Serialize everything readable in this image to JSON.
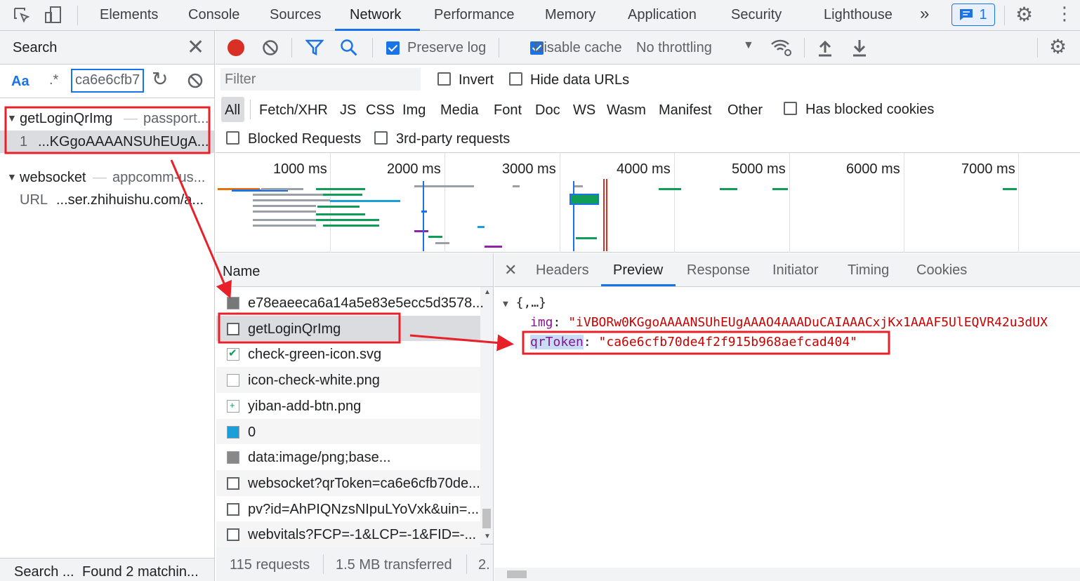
{
  "tabs": [
    "Elements",
    "Console",
    "Sources",
    "Network",
    "Performance",
    "Memory",
    "Application",
    "Security",
    "Lighthouse"
  ],
  "more_tabs": "»",
  "issues_count": "1",
  "search": {
    "title": "Search",
    "case_label": "Aa",
    "regex_label": ".*",
    "query": "ca6e6cfb7",
    "results": [
      {
        "name": "getLoginQrImg",
        "sep": "—",
        "source": "passport...",
        "line": "1",
        "match": "...KGgoAAAANSUhEUgA..."
      },
      {
        "name": "websocket",
        "sep": "—",
        "source": "appcomm-us...",
        "line": "URL",
        "match": "...ser.zhihuishu.com/a..."
      }
    ],
    "status_left": "Search ...",
    "status_right": "Found 2 matchin..."
  },
  "toolbar": {
    "preserve_log": "Preserve log",
    "disable_cache": "Disable cache",
    "throttling": "No throttling"
  },
  "filter": {
    "placeholder": "Filter",
    "invert": "Invert",
    "hide_data_urls": "Hide data URLs",
    "has_blocked_cookies": "Has blocked cookies",
    "blocked_requests": "Blocked Requests",
    "third_party": "3rd-party requests"
  },
  "types": [
    "All",
    "Fetch/XHR",
    "JS",
    "CSS",
    "Img",
    "Media",
    "Font",
    "Doc",
    "WS",
    "Wasm",
    "Manifest",
    "Other"
  ],
  "overview_ticks": [
    "1000 ms",
    "2000 ms",
    "3000 ms",
    "4000 ms",
    "5000 ms",
    "6000 ms",
    "7000 ms"
  ],
  "name_header": "Name",
  "requests": [
    "e78eaeeca6a14a5e83e5ecc5d3578...",
    "getLoginQrImg",
    "check-green-icon.svg",
    "icon-check-white.png",
    "yiban-add-btn.png",
    "0",
    "data:image/png;base...",
    "websocket?qrToken=ca6e6cfb70de...",
    "pv?id=AhPIQNzsNIpuLYoVxk&uin=...",
    "webvitals?FCP=-1&LCP=-1&FID=-..."
  ],
  "summary": {
    "requests": "115 requests",
    "transferred": "1.5 MB transferred",
    "more": "2."
  },
  "detail_tabs": [
    "Headers",
    "Preview",
    "Response",
    "Initiator",
    "Timing",
    "Cookies"
  ],
  "preview": {
    "root": "{,…}",
    "img_key": "img",
    "img_val": "\"iVBORw0KGgoAAAANSUhEUgAAAO4AAADuCAIAAACxjKx1AAAF5UlEQVR42u3dUX",
    "token_key": "qrToken",
    "token_val": "\"ca6e6cfb70de4f2f915b968aefcad404\""
  },
  "colors": {
    "accent": "#1a73e8",
    "annotation": "#e8202a",
    "record": "#d93025"
  }
}
